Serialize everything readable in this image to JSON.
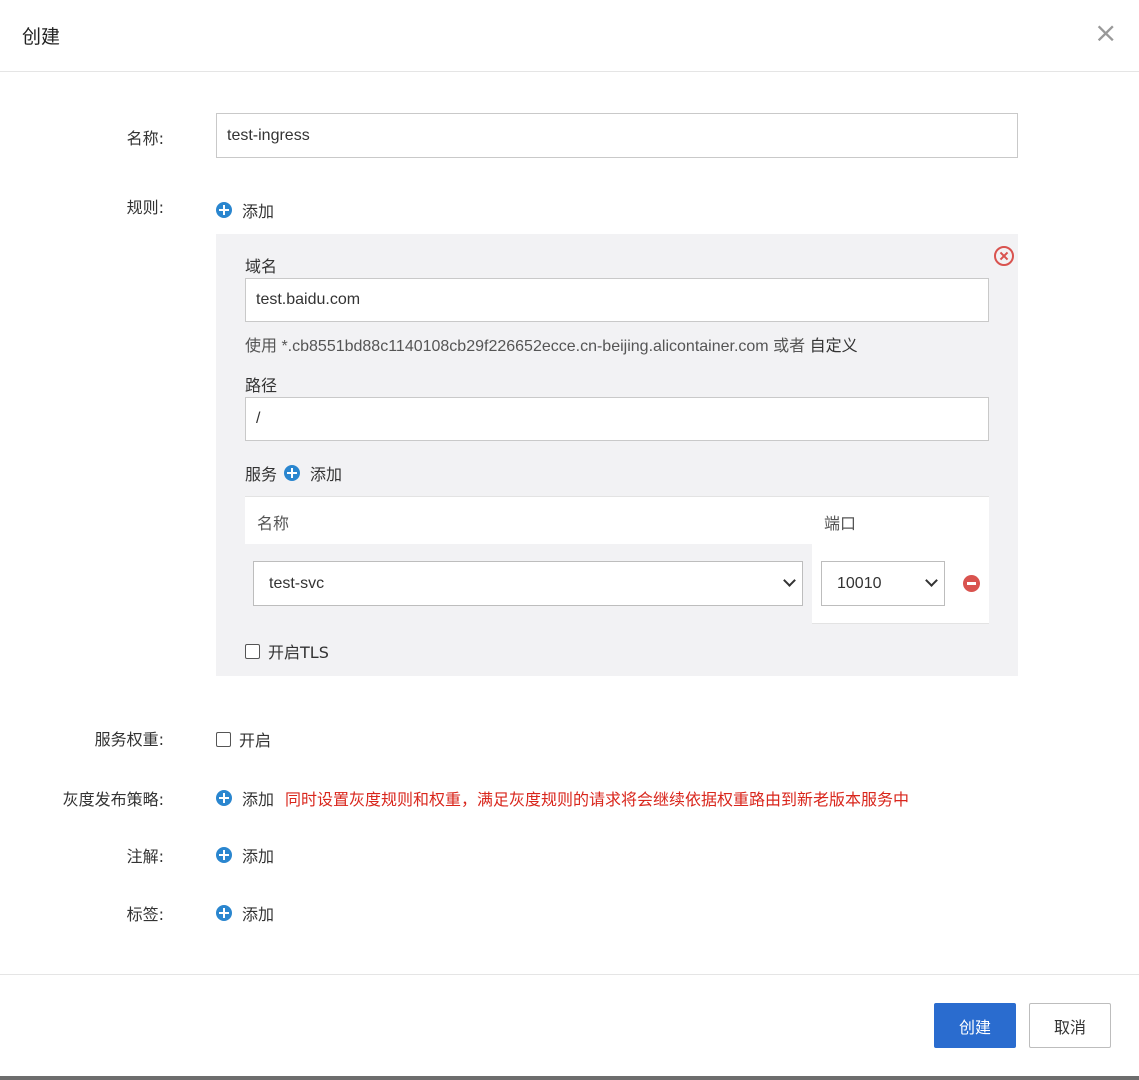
{
  "dialog": {
    "title": "创建",
    "close_icon": "×"
  },
  "form": {
    "name_label": "名称:",
    "name_value": "test-ingress",
    "rules_label": "规则:",
    "rules_add": "添加",
    "rule": {
      "domain_label": "域名",
      "domain_value": "test.baidu.com",
      "hint_prefix": "使用 *.cb8551bd88c1140108cb29f226652ecce.cn-beijing.alicontainer.com",
      "hint_or": "或者",
      "hint_custom": "自定义",
      "path_label": "路径",
      "path_value": "/",
      "service_label": "服务",
      "service_add": "添加",
      "table": {
        "col_name": "名称",
        "col_port": "端口",
        "rows": [
          {
            "service": "test-svc",
            "port": "10010"
          }
        ]
      },
      "tls_label": "开启TLS"
    },
    "weight_label": "服务权重:",
    "weight_enable": "开启",
    "canary_label": "灰度发布策略:",
    "canary_add": "添加",
    "canary_warning": "同时设置灰度规则和权重，满足灰度规则的请求将会继续依据权重路由到新老版本服务中",
    "annotations_label": "注解:",
    "annotations_add": "添加",
    "labels_label": "标签:",
    "labels_add": "添加"
  },
  "footer": {
    "create_button": "创建",
    "cancel_button": "取消"
  },
  "colors": {
    "primary": "#2a6ccf",
    "add_icon": "#2a86cf",
    "danger": "#d9534f",
    "warning_text": "#d9261c"
  }
}
